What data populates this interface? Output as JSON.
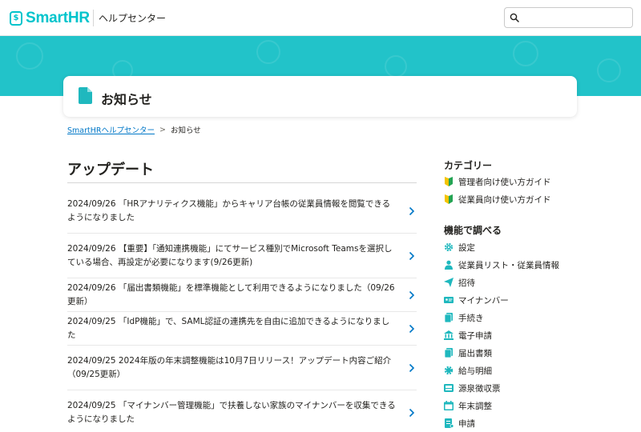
{
  "header": {
    "logo_text": "SmartHR",
    "help_center": "ヘルプセンター",
    "search": {
      "value": "",
      "placeholder": ""
    }
  },
  "page": {
    "title": "お知らせ"
  },
  "breadcrumb": {
    "home": "SmartHRヘルプセンター",
    "separator": ">",
    "current": "お知らせ"
  },
  "section": {
    "title": "アップデート"
  },
  "articles": [
    {
      "text": "2024/09/26 「HRアナリティクス機能」からキャリア台帳の従業員情報を閲覧できるようになりました"
    },
    {
      "text": "2024/09/26 【重要】「通知連携機能」にてサービス種別でMicrosoft Teamsを選択している場合、再設定が必要になります(9/26更新)"
    },
    {
      "text": "2024/09/26 「届出書類機能」を標準機能として利用できるようになりました（09/26更新）"
    },
    {
      "text": "2024/09/25 「IdP機能」で、SAML認証の連携先を自由に追加できるようになりました"
    },
    {
      "text": "2024/09/25 2024年版の年末調整機能は10月7日リリース！アップデート内容ご紹介（09/25更新）"
    },
    {
      "text": "2024/09/25 「マイナンバー管理機能」で扶養しない家族のマイナンバーを収集できるようになりました"
    }
  ],
  "sidebar": {
    "category_heading": "カテゴリー",
    "categories": [
      {
        "label": "管理者向け使い方ガイド",
        "icon": "beginner-leaf-icon"
      },
      {
        "label": "従業員向け使い方ガイド",
        "icon": "beginner-leaf-icon"
      }
    ],
    "feature_heading": "機能で調べる",
    "features": [
      {
        "label": "設定",
        "icon": "gear-icon"
      },
      {
        "label": "従業員リスト・従業員情報",
        "icon": "person-icon"
      },
      {
        "label": "招待",
        "icon": "paper-plane-icon"
      },
      {
        "label": "マイナンバー",
        "icon": "id-card-icon"
      },
      {
        "label": "手続き",
        "icon": "documents-icon"
      },
      {
        "label": "電子申請",
        "icon": "building-icon"
      },
      {
        "label": "届出書類",
        "icon": "documents-icon"
      },
      {
        "label": "給与明細",
        "icon": "gear-badge-icon"
      },
      {
        "label": "源泉徴収票",
        "icon": "tray-icon"
      },
      {
        "label": "年末調整",
        "icon": "calendar-icon"
      },
      {
        "label": "申請",
        "icon": "form-icon"
      }
    ]
  },
  "colors": {
    "brand": "#00c4cc",
    "hero": "#22c3c9",
    "link": "#0077c7",
    "icon_teal": "#1fb8be",
    "text": "#23221f"
  }
}
